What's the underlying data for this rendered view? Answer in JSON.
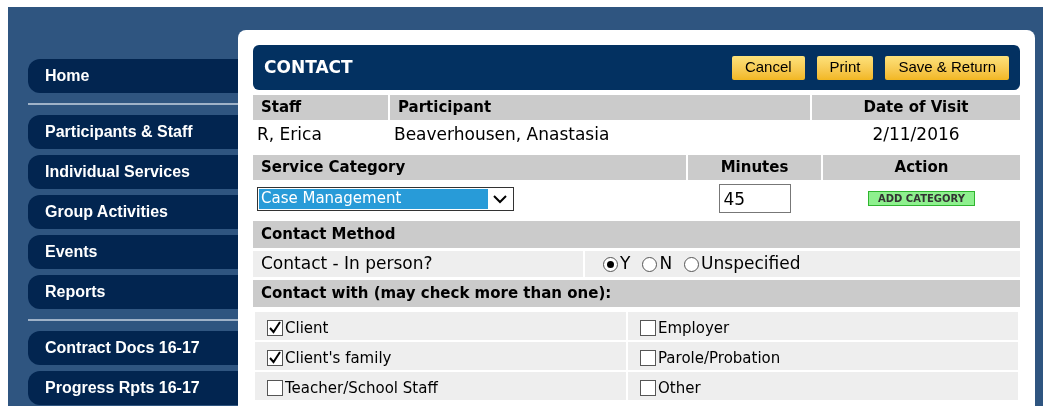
{
  "sidebar": {
    "groups": [
      [
        {
          "label": "Home"
        }
      ],
      [
        {
          "label": "Participants & Staff"
        },
        {
          "label": "Individual Services"
        },
        {
          "label": "Group Activities"
        },
        {
          "label": "Events"
        },
        {
          "label": "Reports"
        }
      ],
      [
        {
          "label": "Contract Docs 16-17"
        },
        {
          "label": "Progress Rpts 16-17"
        }
      ]
    ]
  },
  "header": {
    "title": "CONTACT",
    "buttons": [
      "Cancel",
      "Print",
      "Save & Return"
    ]
  },
  "visit": {
    "columns": [
      "Staff",
      "Participant",
      "Date of Visit"
    ],
    "values": [
      "R, Erica",
      "Beaverhousen, Anastasia",
      "2/11/2016"
    ]
  },
  "service": {
    "columns": [
      "Service Category",
      "Minutes",
      "Action"
    ],
    "category": "Case Management",
    "minutes": "45",
    "action": "ADD CATEGORY"
  },
  "contact_method": {
    "title": "Contact Method",
    "question": "Contact - In person?",
    "options": [
      {
        "label": "Y",
        "selected": true
      },
      {
        "label": "N",
        "selected": false
      },
      {
        "label": "Unspecified",
        "selected": false
      }
    ]
  },
  "contact_with": {
    "title": "Contact with (may check more than one):",
    "rows": [
      [
        {
          "label": "Client",
          "checked": true
        },
        {
          "label": "Employer",
          "checked": false
        }
      ],
      [
        {
          "label": "Client's family",
          "checked": true
        },
        {
          "label": "Parole/Probation",
          "checked": false
        }
      ],
      [
        {
          "label": "Teacher/School Staff",
          "checked": false
        },
        {
          "label": "Other",
          "checked": false
        }
      ]
    ]
  }
}
